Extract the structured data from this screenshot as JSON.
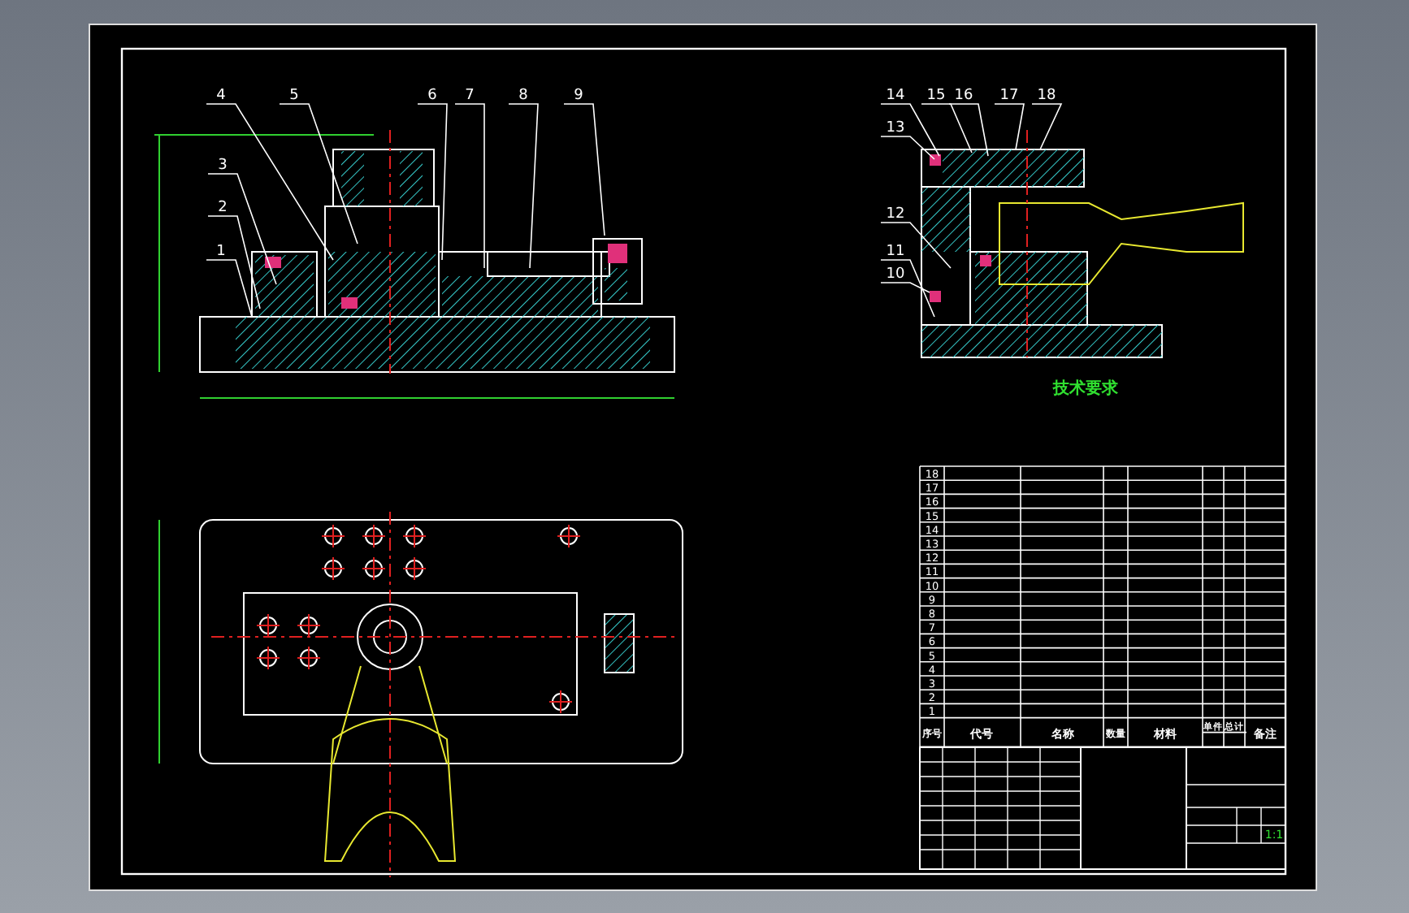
{
  "drawing": {
    "front_callouts": [
      "4",
      "5",
      "6",
      "7",
      "8",
      "9",
      "3",
      "2",
      "1"
    ],
    "side_callouts": [
      "14",
      "15",
      "16",
      "17",
      "18",
      "13",
      "12",
      "11",
      "10"
    ]
  },
  "technical_requirements": {
    "title": "技术要求"
  },
  "parts_list": {
    "columns": [
      "序号",
      "代号",
      "名称",
      "数量",
      "材料",
      "单件",
      "总计",
      "备注"
    ],
    "rows": [
      {
        "number": "18"
      },
      {
        "number": "17"
      },
      {
        "number": "16"
      },
      {
        "number": "15"
      },
      {
        "number": "14"
      },
      {
        "number": "13"
      },
      {
        "number": "12"
      },
      {
        "number": "11"
      },
      {
        "number": "10"
      },
      {
        "number": "9"
      },
      {
        "number": "8"
      },
      {
        "number": "7"
      },
      {
        "number": "6"
      },
      {
        "number": "5"
      },
      {
        "number": "4"
      },
      {
        "number": "3"
      },
      {
        "number": "2"
      },
      {
        "number": "1"
      }
    ]
  },
  "title_block": {
    "scale": "1:1"
  }
}
